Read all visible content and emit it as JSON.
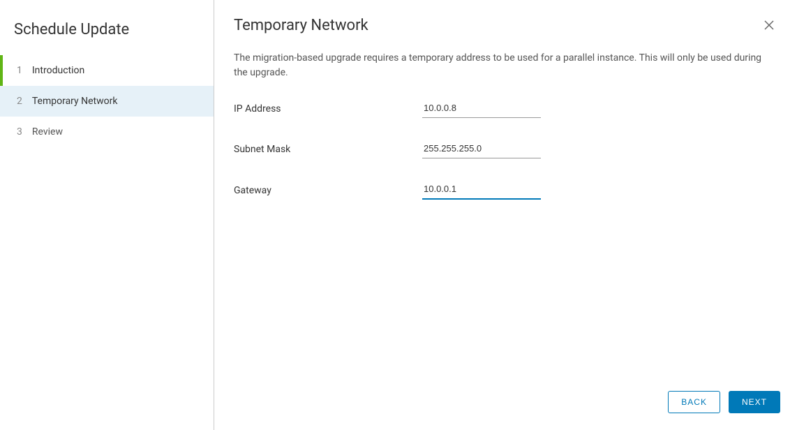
{
  "sidebar": {
    "title": "Schedule Update",
    "steps": [
      {
        "number": "1",
        "label": "Introduction"
      },
      {
        "number": "2",
        "label": "Temporary Network"
      },
      {
        "number": "3",
        "label": "Review"
      }
    ]
  },
  "main": {
    "title": "Temporary Network",
    "description": "The migration-based upgrade requires a temporary address to be used for a parallel instance. This will only be used during the upgrade.",
    "fields": {
      "ip_address": {
        "label": "IP Address",
        "value": "10.0.0.8"
      },
      "subnet_mask": {
        "label": "Subnet Mask",
        "value": "255.255.255.0"
      },
      "gateway": {
        "label": "Gateway",
        "value": "10.0.0.1"
      }
    }
  },
  "footer": {
    "back": "Back",
    "next": "Next"
  }
}
